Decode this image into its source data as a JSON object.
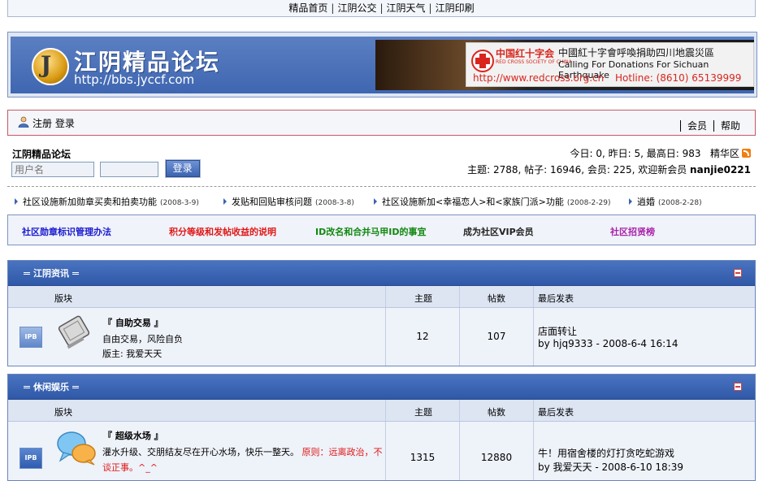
{
  "topnav": [
    "精品首页",
    "江阴公交",
    "江阴天气",
    "江阴印刷"
  ],
  "header": {
    "logo_title": "江阴精品论坛",
    "logo_url": "http://bbs.jyccf.com",
    "banner": {
      "org_cn": "中国红十字会",
      "org_en": "RED CROSS SOCIETY OF CHINA",
      "headline_cn": "中國紅十字會呼喚捐助四川地震災區",
      "headline_en": "Calling For Donations For Sichuan Earthquake",
      "url": "http://www.redcross.org.cn",
      "hotline": "Hotline: (8610) 65139999"
    }
  },
  "userbar": {
    "register": "注册",
    "login": "登录",
    "members": "会员",
    "help": "帮助"
  },
  "forum_name": "江阴精品论坛",
  "login_form": {
    "username_placeholder": "用户名",
    "password_value": "",
    "submit": "登录"
  },
  "stats": {
    "line1": "今日: 0, 昨日: 5, 最高日: 983",
    "digest": "精华区",
    "line2": "主题: 2788, 帖子: 16946, 会员: 225, 欢迎新会员",
    "new_member": "nanjie0221"
  },
  "news": [
    {
      "title": "社区设施新加勋章买卖和拍卖功能",
      "date": "(2008-3-9)"
    },
    {
      "title": "发贴和回贴审核问题",
      "date": "(2008-3-8)"
    },
    {
      "title": "社区设施新加<幸福恋人>和<家族门派>功能",
      "date": "(2008-2-29)"
    },
    {
      "title": "逍婚",
      "date": "(2008-2-28)"
    }
  ],
  "notices": [
    {
      "text": "社区勋章标识管理办法",
      "color": "#1a1ad0"
    },
    {
      "text": "积分等级和发帖收益的说明",
      "color": "#e01818"
    },
    {
      "text": "ID改名和合并马甲ID的事宜",
      "color": "#118811"
    },
    {
      "text": "成为社区VIP会员",
      "color": "#222222"
    },
    {
      "text": "社区招贤榜",
      "color": "#aa22aa"
    }
  ],
  "table_headers": {
    "forum": "版块",
    "topics": "主题",
    "posts": "帖数",
    "last": "最后发表"
  },
  "categories": [
    {
      "title": "江阴资讯",
      "forums": [
        {
          "icon": "IPB",
          "name": "『 自助交易 』",
          "desc": "自由交易，风险自负",
          "mod": "版主: 我爱天天",
          "topics": "12",
          "posts": "107",
          "last_title": "店面转让",
          "last_by": "by hjq9333 - 2008-6-4 16:14"
        }
      ]
    },
    {
      "title": "休闲娱乐",
      "forums": [
        {
          "icon": "IPB",
          "name": "『 超级水场 』",
          "desc": "灌水升级、交朋结友尽在开心水场，快乐一整天。",
          "desc_red": "原则：远离政治，不谈正事。^_^",
          "topics": "1315",
          "posts": "12880",
          "last_title": "牛！用宿舍楼的灯打贪吃蛇游戏",
          "last_by": "by 我爱天天 - 2008-6-10 18:39"
        }
      ]
    }
  ]
}
